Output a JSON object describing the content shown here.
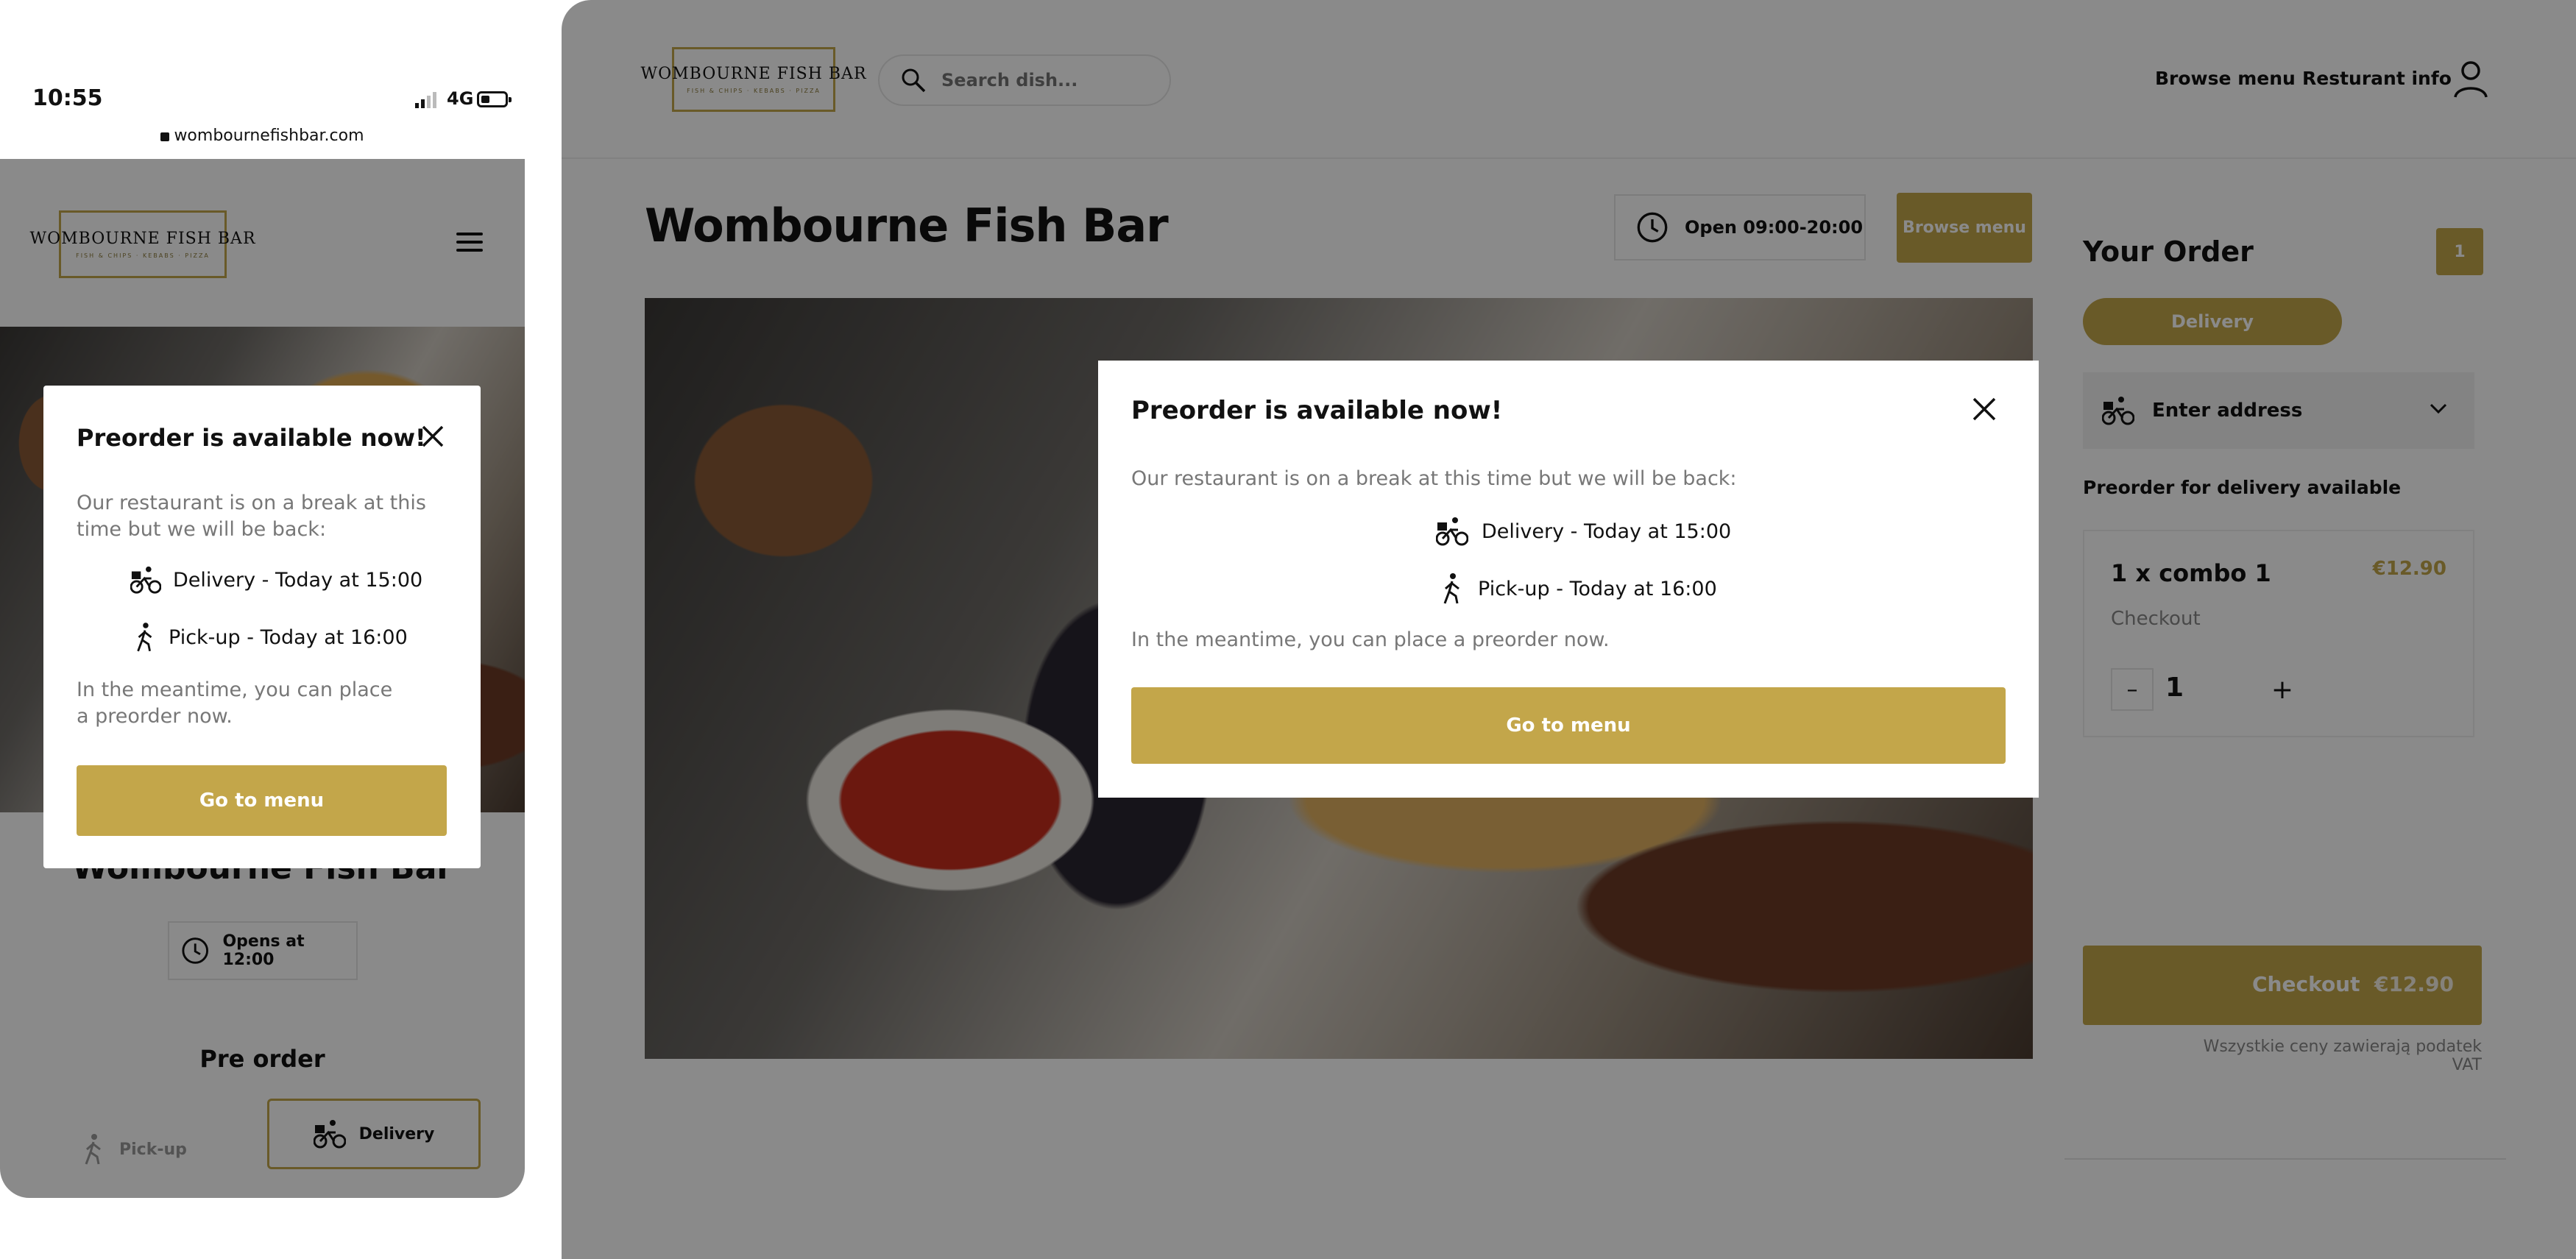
{
  "mobile": {
    "status_time": "10:55",
    "network": "4G",
    "url": "wombournefishbar.com",
    "logo_title": "WOMBOURNE FISH BAR",
    "logo_subtitle": "FISH & CHIPS · KEBABS · PIZZA",
    "restaurant_name": "Wombourne Fish Bar",
    "hours": "Opens at 12:00",
    "section_title": "Pre order",
    "pickup_label": "Pick-up",
    "delivery_label": "Delivery",
    "modal": {
      "title": "Preorder is available now!",
      "break_text": "Our restaurant is on a break at this time but we will be back:",
      "delivery_time": "Delivery - Today at 15:00",
      "pickup_time": "Pick-up - Today at 16:00",
      "meantime_text": "In the meantime, you can place a preorder now.",
      "button": "Go to menu"
    }
  },
  "desktop": {
    "logo_title": "WOMBOURNE FISH BAR",
    "logo_subtitle": "FISH & CHIPS · KEBABS · PIZZA",
    "search_placeholder": "Search dish...",
    "nav": [
      "Browse menu",
      "Resturant info"
    ],
    "restaurant_name": "Wombourne Fish Bar",
    "hours": "Open 09:00-20:00",
    "browse_button": "Browse menu",
    "order": {
      "title": "Your Order",
      "count": "1",
      "mode": "Delivery",
      "address_placeholder": "Enter address",
      "preorder_note": "Preorder for delivery available",
      "item_name": "1 x combo 1",
      "item_price": "€12.90",
      "item_sub": "Checkout",
      "quantity": "1",
      "checkout_label": "Checkout",
      "checkout_total": "€12.90",
      "vat_note": "Wszystkie ceny zawierają podatek VAT"
    },
    "modal": {
      "title": "Preorder is available now!",
      "break_text": "Our restaurant is on a break at this time but we will be back:",
      "delivery_time": "Delivery - Today at 15:00",
      "pickup_time": "Pick-up - Today at 16:00",
      "meantime_text": "In the meantime, you can place a preorder now.",
      "button": "Go to menu"
    }
  },
  "colors": {
    "accent": "#c3a64a",
    "overlay": "rgba(0,0,0,0.46)",
    "muted_text": "#777777"
  },
  "icons": [
    "signal-icon",
    "battery-icon",
    "lock-icon",
    "hamburger-menu-icon",
    "clock-icon",
    "walking-person-icon",
    "delivery-bike-icon",
    "search-icon",
    "user-icon",
    "close-icon",
    "chevron-down-icon"
  ]
}
